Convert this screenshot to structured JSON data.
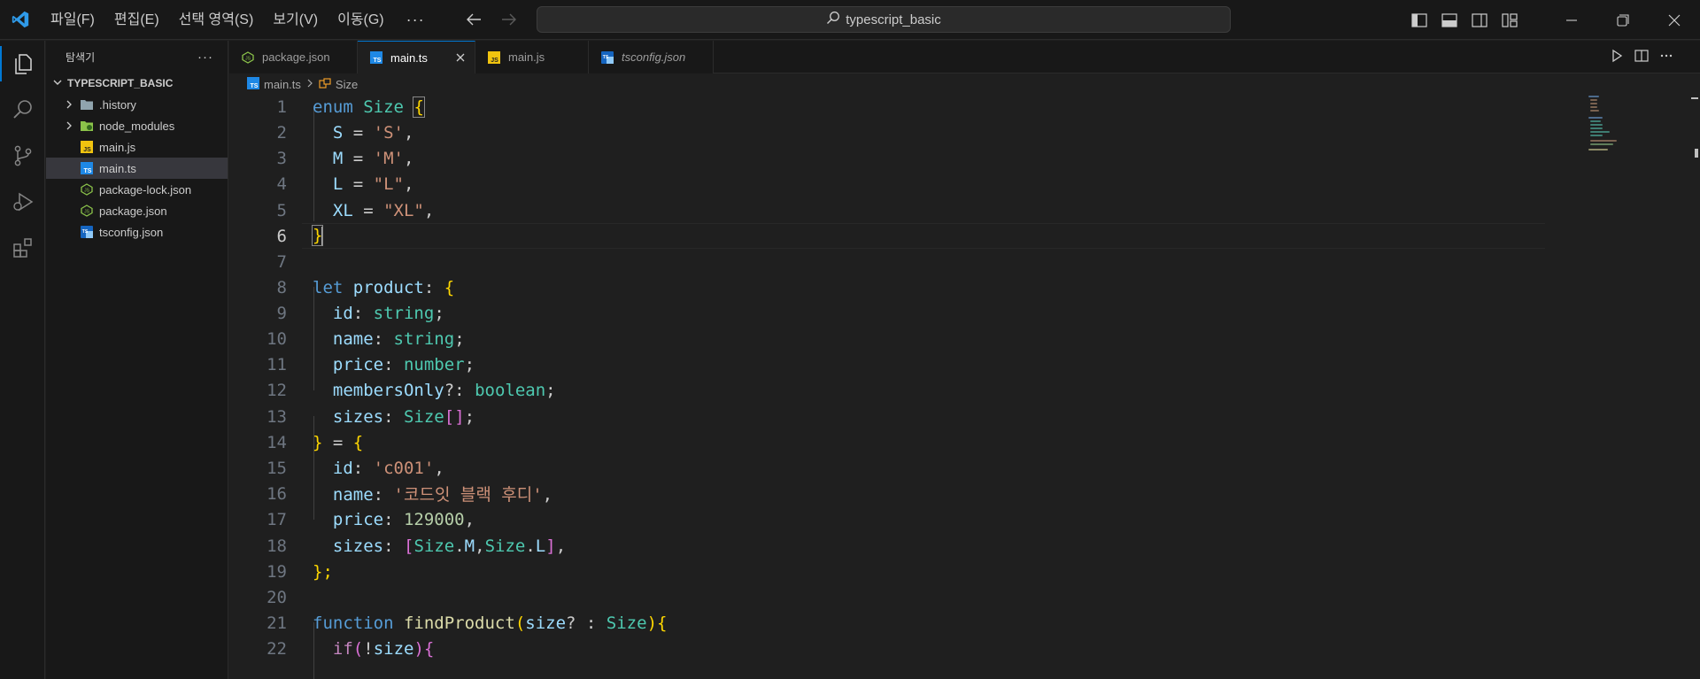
{
  "titlebar": {
    "menus": [
      "파일(F)",
      "편집(E)",
      "선택 영역(S)",
      "보기(V)",
      "이동(G)"
    ],
    "more": "···",
    "search_text": "typescript_basic"
  },
  "sidebar": {
    "header": "탐색기",
    "more": "···",
    "folder": "TYPESCRIPT_BASIC",
    "items": [
      {
        "label": ".history",
        "kind": "folder",
        "icon": "folder-icon"
      },
      {
        "label": "node_modules",
        "kind": "folder",
        "icon": "node-folder-icon"
      },
      {
        "label": "main.js",
        "kind": "file",
        "icon": "js-file-icon"
      },
      {
        "label": "main.ts",
        "kind": "file",
        "icon": "ts-file-icon"
      },
      {
        "label": "package-lock.json",
        "kind": "file",
        "icon": "node-json-icon"
      },
      {
        "label": "package.json",
        "kind": "file",
        "icon": "node-json-icon"
      },
      {
        "label": "tsconfig.json",
        "kind": "file",
        "icon": "tsconfig-icon"
      }
    ]
  },
  "tabs": [
    {
      "label": "package.json",
      "active": false
    },
    {
      "label": "main.ts",
      "active": true
    },
    {
      "label": "main.js",
      "active": false
    },
    {
      "label": "tsconfig.json",
      "active": false
    }
  ],
  "breadcrumb": {
    "file": "main.ts",
    "symbol": "Size"
  },
  "editor": {
    "current_line": 6,
    "line_numbers": [
      "1",
      "2",
      "3",
      "4",
      "5",
      "6",
      "7",
      "8",
      "9",
      "10",
      "11",
      "12",
      "13",
      "14",
      "15",
      "16",
      "17",
      "18",
      "19",
      "20",
      "21",
      "22"
    ],
    "tokens": {
      "enum": "enum",
      "Size": "Size",
      "lbrace": "{",
      "rbrace": "}",
      "S": "S",
      "M": "M",
      "L": "L",
      "XL": "XL",
      "eq": " = ",
      "comma": ",",
      "sS": "'S'",
      "sM": "'M'",
      "sL": "\"L\"",
      "sXL": "\"XL\"",
      "let": "let",
      "product": "product",
      "colon": ":",
      "colon_sp": ": ",
      "id": "id",
      "name": "name",
      "price": "price",
      "membersOnly": "membersOnly",
      "optcolon": "?: ",
      "sizes": "sizes",
      "string": "string",
      "number": "number",
      "boolean": "boolean",
      "semi": ";",
      "lbrack": "[",
      "rbrack": "]",
      "close_eq": " = ",
      "sc001": "'c001'",
      "sname": "'코드잇 블랙 후디'",
      "n129000": "129000",
      "dot": ".",
      "close_semi": "};",
      "function": "function",
      "findProduct": "findProduct",
      "lparen": "(",
      "rparen": ")",
      "size": "size",
      "q_colon": "? : ",
      "if": "if",
      "bang": "!"
    }
  },
  "colors": {
    "accent": "#0078d4",
    "keyword": "#569cd6",
    "type": "#4ec9b0",
    "string": "#ce9178"
  }
}
